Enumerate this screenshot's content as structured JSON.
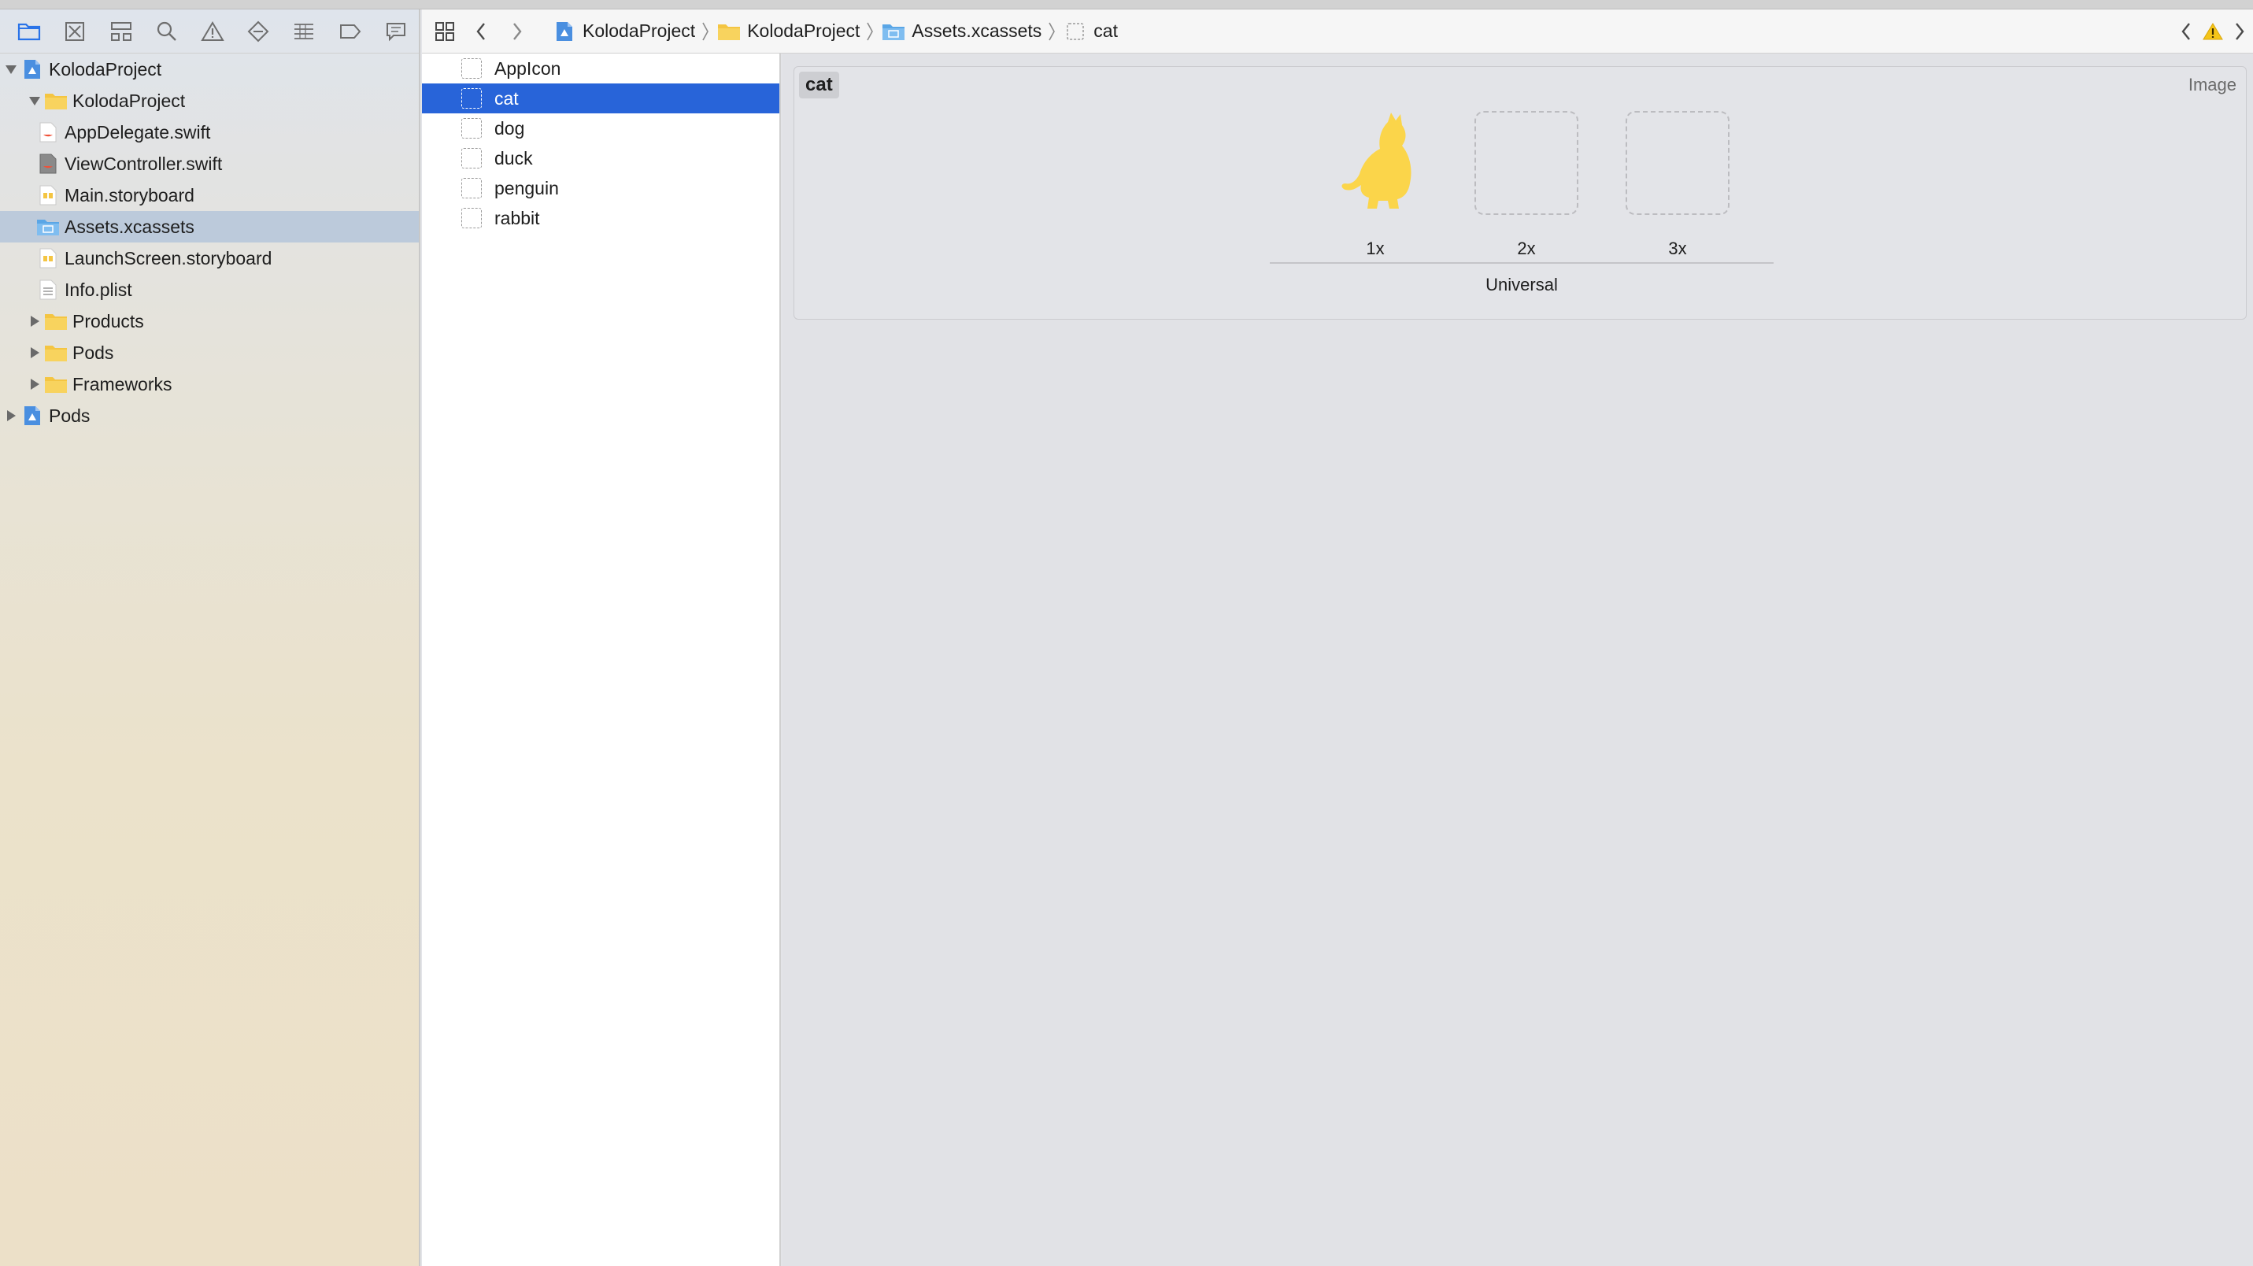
{
  "navigator": {
    "toolbar_icons": [
      "folder-icon",
      "source-control-icon",
      "symbol-hierarchy-icon",
      "search-icon",
      "warning-triangle-icon",
      "test-diamond-icon",
      "debug-list-icon",
      "breakpoint-tag-icon",
      "report-bubble-icon"
    ],
    "tree": [
      {
        "label": "KolodaProject",
        "kind": "project",
        "level": 0,
        "expanded": true
      },
      {
        "label": "KolodaProject",
        "kind": "folder",
        "level": 1,
        "expanded": true
      },
      {
        "label": "AppDelegate.swift",
        "kind": "swift",
        "level": 2
      },
      {
        "label": "ViewController.swift",
        "kind": "swift-dark",
        "level": 2
      },
      {
        "label": "Main.storyboard",
        "kind": "storyboard",
        "level": 2
      },
      {
        "label": "Assets.xcassets",
        "kind": "assets",
        "level": 2,
        "selected": true
      },
      {
        "label": "LaunchScreen.storyboard",
        "kind": "storyboard",
        "level": 2
      },
      {
        "label": "Info.plist",
        "kind": "plist",
        "level": 2
      },
      {
        "label": "Products",
        "kind": "folder",
        "level": 1,
        "expanded": false
      },
      {
        "label": "Pods",
        "kind": "folder",
        "level": 1,
        "expanded": false
      },
      {
        "label": "Frameworks",
        "kind": "folder",
        "level": 1,
        "expanded": false
      },
      {
        "label": "Pods",
        "kind": "project",
        "level": 0,
        "expanded": false
      }
    ]
  },
  "jumpbar": {
    "crumbs": [
      {
        "label": "KolodaProject",
        "icon": "project"
      },
      {
        "label": "KolodaProject",
        "icon": "folder"
      },
      {
        "label": "Assets.xcassets",
        "icon": "assets"
      },
      {
        "label": "cat",
        "icon": "imageset"
      }
    ]
  },
  "asset_list": [
    {
      "label": "AppIcon"
    },
    {
      "label": "cat",
      "selected": true
    },
    {
      "label": "dog"
    },
    {
      "label": "duck"
    },
    {
      "label": "penguin"
    },
    {
      "label": "rabbit"
    }
  ],
  "editor": {
    "asset_name": "cat",
    "asset_type": "Image",
    "slots": [
      {
        "label": "1x",
        "filled": true
      },
      {
        "label": "2x",
        "filled": false
      },
      {
        "label": "3x",
        "filled": false
      }
    ],
    "group_label": "Universal"
  },
  "colors": {
    "selection_blue": "#2864d9",
    "sidebar_selection": "#bccadb",
    "folder_yellow": "#f4c542",
    "cat_yellow": "#fbd54a",
    "warning_yellow": "#f5c518"
  }
}
